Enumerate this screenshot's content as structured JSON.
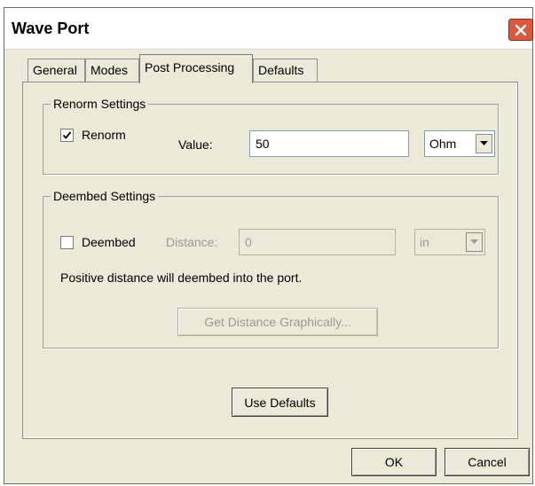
{
  "window": {
    "title": "Wave Port",
    "close_icon": "close-icon"
  },
  "tabs": [
    {
      "label": "General",
      "active": false
    },
    {
      "label": "Modes",
      "active": false
    },
    {
      "label": "Post Processing",
      "active": true
    },
    {
      "label": "Defaults",
      "active": false
    }
  ],
  "renorm": {
    "group_label": "Renorm Settings",
    "checkbox_label": "Renorm",
    "checked": true,
    "value_label": "Value:",
    "value": "50",
    "unit": "Ohm"
  },
  "deembed": {
    "group_label": "Deembed Settings",
    "checkbox_label": "Deembed",
    "checked": false,
    "distance_label": "Distance:",
    "distance_value": "0",
    "unit": "in",
    "note": "Positive distance will deembed into the port.",
    "graphic_button": "Get Distance Graphically..."
  },
  "buttons": {
    "use_defaults": "Use Defaults",
    "ok": "OK",
    "cancel": "Cancel"
  },
  "colors": {
    "dialog_bg": "#ece9d8",
    "close_button": "#d9593f",
    "disabled_text": "#9a9a9a"
  }
}
